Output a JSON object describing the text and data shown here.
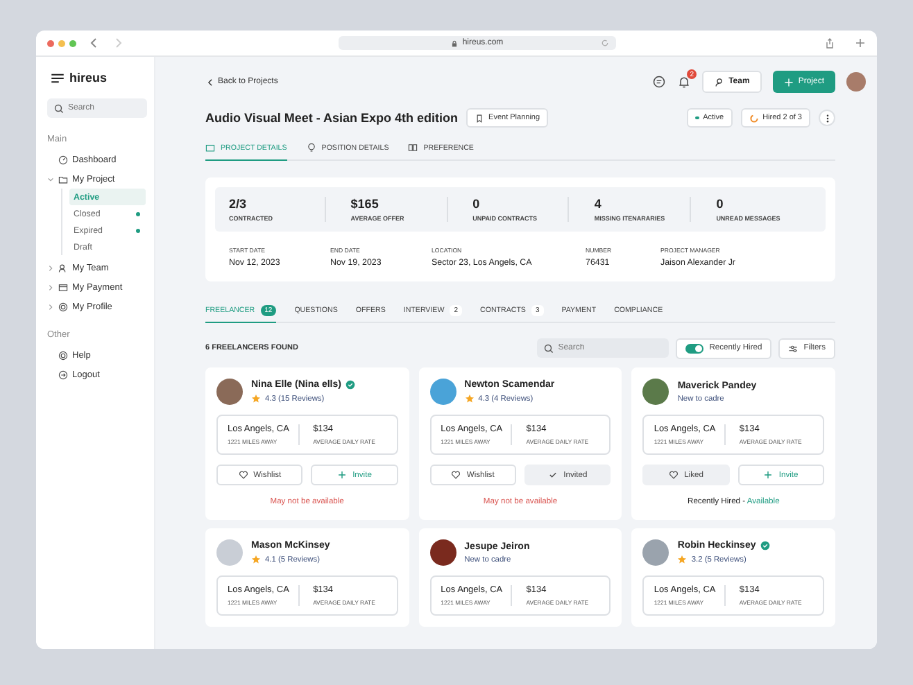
{
  "browser": {
    "url": "hireus.com"
  },
  "sidebar": {
    "logo": "hireus",
    "search_placeholder": "Search",
    "sections": [
      {
        "title": "Main",
        "items": [
          {
            "label": "Dashboard"
          },
          {
            "label": "My Project",
            "expanded": true,
            "children": [
              {
                "label": "Active",
                "selected": true,
                "dot": false
              },
              {
                "label": "Closed",
                "selected": false,
                "dot": true
              },
              {
                "label": "Expired",
                "selected": false,
                "dot": true
              },
              {
                "label": "Draft",
                "selected": false,
                "dot": false
              }
            ]
          },
          {
            "label": "My Team",
            "expanded": false
          },
          {
            "label": "My Payment",
            "expanded": false
          },
          {
            "label": "My Profile",
            "expanded": false
          }
        ]
      },
      {
        "title": "Other",
        "items": [
          {
            "label": "Help"
          },
          {
            "label": "Logout"
          }
        ]
      }
    ]
  },
  "topbar": {
    "back_link": "Back to Projects",
    "notification_count": "2",
    "team_button": "Team",
    "project_button": "Project"
  },
  "project": {
    "title": "Audio Visual Meet - Asian Expo 4th edition",
    "tag": "Event Planning",
    "status": "Active",
    "hired": "Hired 2 of 3",
    "tabs": [
      {
        "label": "PROJECT DETAILS",
        "selected": true
      },
      {
        "label": "POSITION DETAILS",
        "selected": false
      },
      {
        "label": "PREFERENCE",
        "selected": false
      }
    ]
  },
  "stats": [
    {
      "value": "2/3",
      "label": "CONTRACTED"
    },
    {
      "value": "$165",
      "label": "AVERAGE OFFER"
    },
    {
      "value": "0",
      "label": "UNPAID CONTRACTS"
    },
    {
      "value": "4",
      "label": "MISSING ITENARARIES"
    },
    {
      "value": "0",
      "label": "UNREAD MESSAGES"
    }
  ],
  "details": [
    {
      "label": "START DATE",
      "value": "Nov 12, 2023"
    },
    {
      "label": "END DATE",
      "value": "Nov 19, 2023"
    },
    {
      "label": "LOCATION",
      "value": "Sector 23, Los Angels, CA"
    },
    {
      "label": "NUMBER",
      "value": "76431"
    },
    {
      "label": "PROJECT MANAGER",
      "value": "Jaison Alexander Jr"
    }
  ],
  "freelancer_tabs": [
    {
      "label": "FREELANCER",
      "count": "12",
      "selected": true
    },
    {
      "label": "QUESTIONS",
      "selected": false
    },
    {
      "label": "OFFERS",
      "selected": false
    },
    {
      "label": "INTERVIEW",
      "count": "2",
      "selected": false
    },
    {
      "label": "CONTRACTS",
      "count": "3",
      "selected": false
    },
    {
      "label": "PAYMENT",
      "selected": false
    },
    {
      "label": "COMPLIANCE",
      "selected": false
    }
  ],
  "results": {
    "count_text": "6 FREELANCERS FOUND",
    "search_placeholder": "Search",
    "toggle": {
      "label": "Recently Hired",
      "on": true
    },
    "filters": "Filters"
  },
  "cards": [
    {
      "name": "Nina Elle (Nina ells)",
      "verified": true,
      "rating": "4.3 (15 Reviews)",
      "location": "Los Angels, CA",
      "distance": "1221 MILES AWAY",
      "rate": "$134",
      "rate_label": "AVERAGE DAILY RATE",
      "like": {
        "label": "Wishlist",
        "selected": false
      },
      "invite": {
        "label": "Invite",
        "selected": false
      },
      "status": {
        "kind": "unavailable",
        "text": "May not be available"
      }
    },
    {
      "name": "Newton Scamendar",
      "verified": false,
      "rating": "4.3 (4 Reviews)",
      "location": "Los Angels, CA",
      "distance": "1221 MILES AWAY",
      "rate": "$134",
      "rate_label": "AVERAGE DAILY RATE",
      "like": {
        "label": "Wishlist",
        "selected": false
      },
      "invite": {
        "label": "Invited",
        "selected": true
      },
      "status": {
        "kind": "unavailable",
        "text": "May not be available"
      }
    },
    {
      "name": "Maverick Pandey",
      "verified": false,
      "subtitle": "New to cadre",
      "location": "Los Angels, CA",
      "distance": "1221 MILES AWAY",
      "rate": "$134",
      "rate_label": "AVERAGE DAILY RATE",
      "like": {
        "label": "Liked",
        "selected": true
      },
      "invite": {
        "label": "Invite",
        "selected": false
      },
      "status": {
        "kind": "available",
        "text": "Recently Hired -",
        "highlight": "Available"
      }
    },
    {
      "name": "Mason McKinsey",
      "verified": false,
      "rating": "4.1 (5 Reviews)",
      "location": "Los Angels, CA",
      "distance": "1221 MILES AWAY",
      "rate": "$134",
      "rate_label": "AVERAGE DAILY RATE"
    },
    {
      "name": "Jesupe Jeiron",
      "verified": false,
      "subtitle": "New to cadre",
      "location": "Los Angels, CA",
      "distance": "1221 MILES AWAY",
      "rate": "$134",
      "rate_label": "AVERAGE DAILY RATE"
    },
    {
      "name": "Robin Heckinsey",
      "verified": true,
      "rating": "3.2 (5 Reviews)",
      "location": "Los Angels, CA",
      "distance": "1221 MILES AWAY",
      "rate": "$134",
      "rate_label": "AVERAGE DAILY RATE"
    }
  ]
}
